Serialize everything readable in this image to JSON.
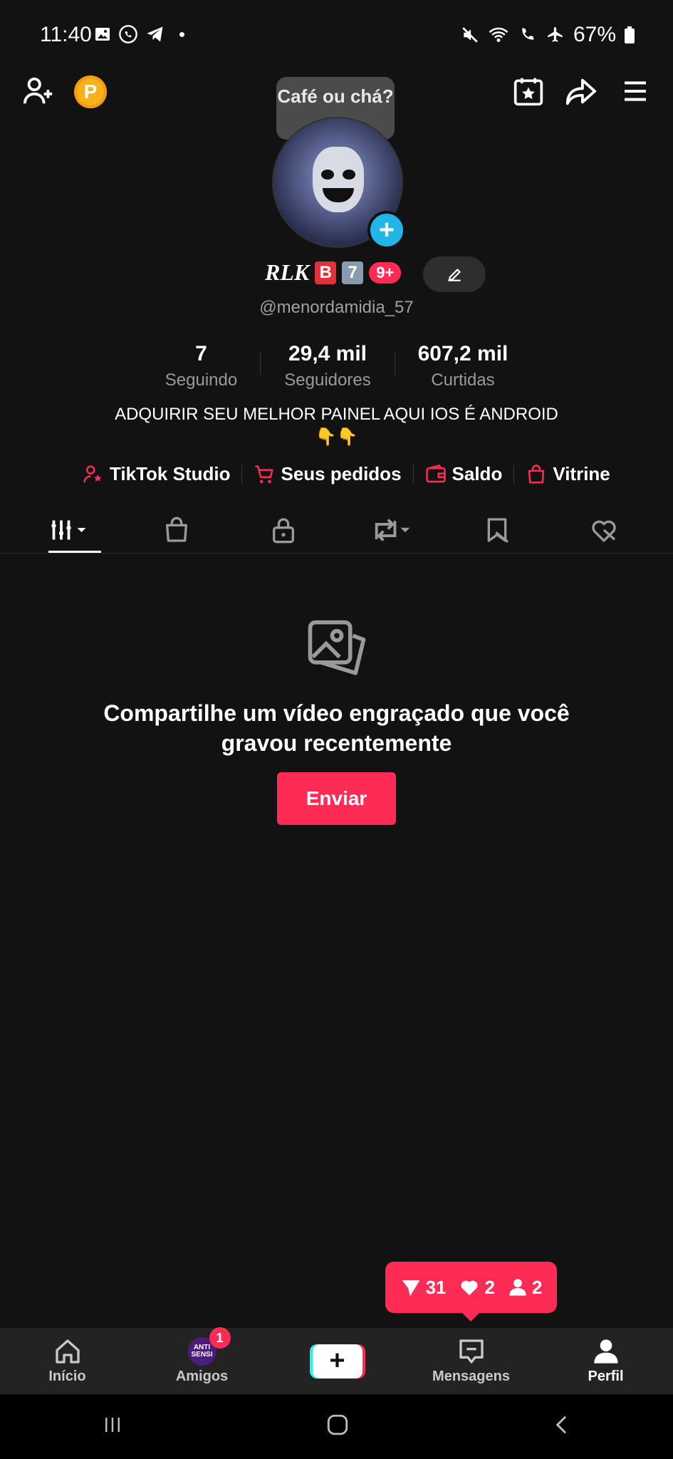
{
  "status_bar": {
    "time": "11:40",
    "battery": "67%"
  },
  "tooltip": {
    "text": "Café ou chá?"
  },
  "profile": {
    "display_name": "RLK",
    "tile_b": "B",
    "tile_7": "7",
    "badge_count": "9+",
    "handle": "@menordamidia_57",
    "bio_line1": "ADQUIRIR SEU MELHOR PAINEL AQUI IOS É ANDROID",
    "bio_line2": "👇👇"
  },
  "stats": [
    {
      "value": "7",
      "label": "Seguindo"
    },
    {
      "value": "29,4 mil",
      "label": "Seguidores"
    },
    {
      "value": "607,2 mil",
      "label": "Curtidas"
    }
  ],
  "links": {
    "studio": "TikTok Studio",
    "orders": "Seus pedidos",
    "balance": "Saldo",
    "showcase": "Vitrine"
  },
  "empty_state": {
    "title_line1": "Compartilhe um vídeo engraçado que você",
    "title_line2": "gravou recentemente",
    "button": "Enviar"
  },
  "notifications": {
    "shares": "31",
    "likes": "2",
    "followers": "2"
  },
  "bottom_nav": {
    "home": "Início",
    "friends": "Amigos",
    "friends_badge": "1",
    "friends_avatar_text": "ANTI SENSI",
    "messages": "Mensagens",
    "profile": "Perfil"
  },
  "colors": {
    "accent": "#fe2c55",
    "cyan": "#25f4ee",
    "background": "#121212",
    "coin": "#f7b21a"
  }
}
